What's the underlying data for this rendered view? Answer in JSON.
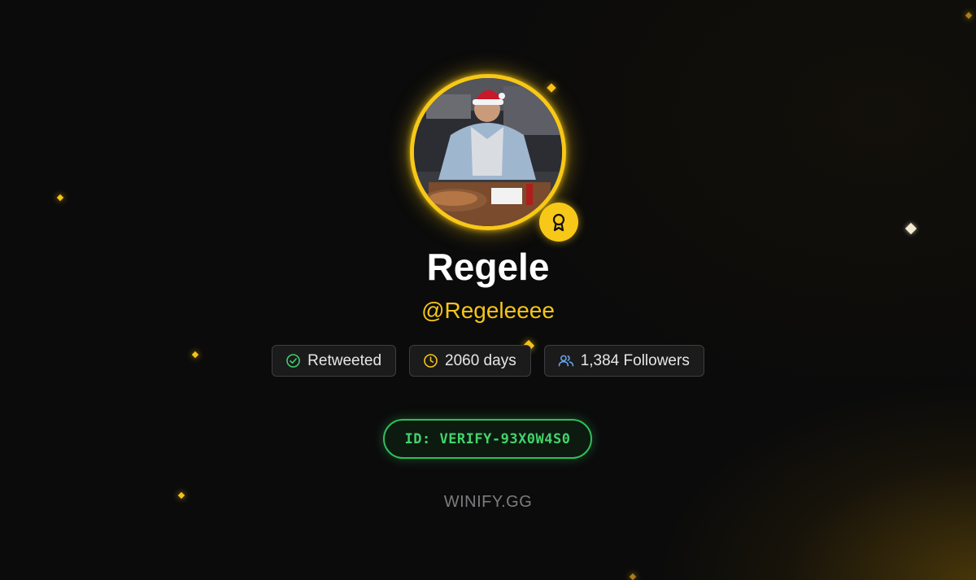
{
  "profile": {
    "name": "Regele",
    "handle": "@Regeleeee"
  },
  "stats": {
    "retweeted_label": "Retweeted",
    "days_label": "2060 days",
    "followers_label": "1,384 Followers"
  },
  "verification": {
    "id_label": "ID: VERIFY-93X0W4S0"
  },
  "footer": {
    "brand": "WINIFY.GG"
  },
  "icons": {
    "award": "award-icon",
    "retweeted": "check-circle-icon",
    "days": "clock-icon",
    "followers": "users-icon"
  },
  "colors": {
    "accent_gold": "#f7c817",
    "handle_gold": "#f5c518",
    "verify_green": "#43d36a",
    "check_green": "#3fcf6a",
    "followers_blue": "#6aa8f0",
    "background": "#0b0b0b"
  }
}
